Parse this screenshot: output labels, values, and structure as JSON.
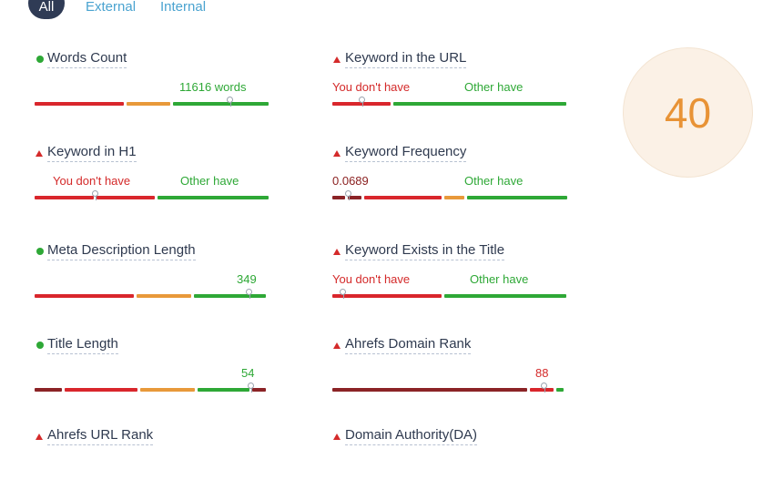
{
  "tabs": {
    "all": "All",
    "external": "External",
    "internal": "Internal"
  },
  "score": "40",
  "metrics": [
    {
      "title": "Words Count",
      "status": "good",
      "value": "11616 words"
    },
    {
      "title": "Keyword in the URL",
      "status": "bad",
      "you": "You don't have",
      "other": "Other have"
    },
    {
      "title": "Keyword in H1",
      "status": "bad",
      "you": "You don't have",
      "other": "Other have"
    },
    {
      "title": "Keyword Frequency",
      "status": "bad",
      "value": "0.0689",
      "other": "Other have"
    },
    {
      "title": "Meta Description Length",
      "status": "good",
      "value": "349"
    },
    {
      "title": "Keyword Exists in the Title",
      "status": "bad",
      "you": "You don't have",
      "other": "Other have"
    },
    {
      "title": "Title Length",
      "status": "good",
      "value": "54"
    },
    {
      "title": "Ahrefs Domain Rank",
      "status": "bad",
      "value": "88"
    },
    {
      "title": "Ahrefs URL Rank",
      "status": "bad"
    },
    {
      "title": "Domain Authority(DA)",
      "status": "bad"
    }
  ],
  "colors": {
    "good": "#2ea836",
    "bad": "#d42a2a",
    "warn": "#e8993a",
    "dark_red": "#8b2326",
    "score": "#e89336",
    "tab_active_bg": "#2f3b55",
    "link": "#4aa3d0"
  },
  "icons": {
    "good": "green-dot-icon",
    "bad": "red-triangle-icon"
  }
}
